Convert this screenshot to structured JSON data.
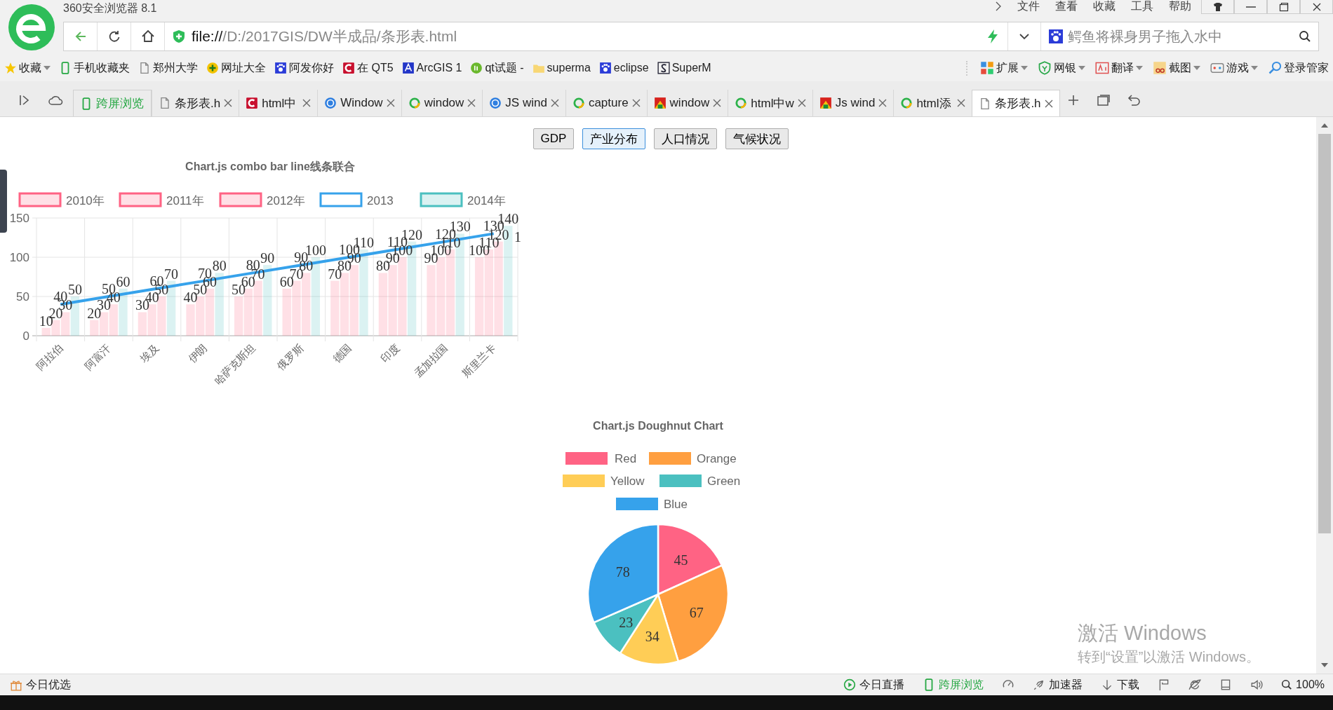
{
  "window": {
    "title": "360安全浏览器 8.1",
    "menu": [
      "文件",
      "查看",
      "收藏",
      "工具",
      "帮助"
    ]
  },
  "address_bar": {
    "scheme": "file://",
    "path": "/D:/2017GIS/DW半成品/条形表.html"
  },
  "search": {
    "value": "鳄鱼将裸身男子拖入水中"
  },
  "bookmarks": [
    {
      "label": "收藏",
      "kind": "star",
      "dropdown": true
    },
    {
      "label": "手机收藏夹",
      "kind": "phone",
      "dropdown": false
    },
    {
      "label": "郑州大学",
      "kind": "page",
      "dropdown": false
    },
    {
      "label": "网址大全",
      "kind": "plus",
      "dropdown": false
    },
    {
      "label": "阿发你好",
      "kind": "paw",
      "dropdown": false
    },
    {
      "label": "在 QT5",
      "kind": "c",
      "dropdown": false
    },
    {
      "label": "ArcGIS 1",
      "kind": "arc",
      "dropdown": false
    },
    {
      "label": "qt试题 -",
      "kind": "leaf",
      "dropdown": false
    },
    {
      "label": "superma",
      "kind": "folder",
      "dropdown": false
    },
    {
      "label": "eclipse",
      "kind": "paw",
      "dropdown": false
    },
    {
      "label": "SuperM",
      "kind": "s",
      "dropdown": false
    }
  ],
  "tools": [
    {
      "label": "扩展",
      "kind": "grid",
      "dropdown": true
    },
    {
      "label": "网银",
      "kind": "shield",
      "dropdown": true
    },
    {
      "label": "翻译",
      "kind": "translate",
      "dropdown": true
    },
    {
      "label": "截图",
      "kind": "scissors",
      "dropdown": true
    },
    {
      "label": "游戏",
      "kind": "game",
      "dropdown": true
    },
    {
      "label": "登录管家",
      "kind": "key",
      "dropdown": false
    }
  ],
  "tabs": [
    {
      "label": "跨屏浏览",
      "kind": "phone",
      "selected": false
    },
    {
      "label": "条形表.h",
      "kind": "page",
      "selected": false
    },
    {
      "label": "html中",
      "kind": "c",
      "selected": false
    },
    {
      "label": "Window",
      "kind": "globe",
      "selected": false
    },
    {
      "label": "window",
      "kind": "ring",
      "selected": false
    },
    {
      "label": "JS wind",
      "kind": "globe",
      "selected": false
    },
    {
      "label": "capture",
      "kind": "ring",
      "selected": false
    },
    {
      "label": "window",
      "kind": "mosaic",
      "selected": false
    },
    {
      "label": "html中w",
      "kind": "ring",
      "selected": false
    },
    {
      "label": "Js wind",
      "kind": "mosaic",
      "selected": false
    },
    {
      "label": "html添",
      "kind": "ring",
      "selected": false
    },
    {
      "label": "条形表.h",
      "kind": "page",
      "selected": true
    }
  ],
  "page": {
    "buttons": [
      {
        "label": "GDP",
        "selected": false
      },
      {
        "label": "产业分布",
        "selected": true
      },
      {
        "label": "人口情况",
        "selected": false
      },
      {
        "label": "气候状况",
        "selected": false
      }
    ],
    "bar_chart": {
      "chart_data": {
        "type": "bar",
        "title": "Chart.js combo bar line线条联合",
        "categories": [
          "阿拉伯",
          "阿富汗",
          "埃及",
          "伊朗",
          "哈萨克斯坦",
          "俄罗斯",
          "德国",
          "印度",
          "孟加拉国",
          "斯里兰卡"
        ],
        "series": [
          {
            "name": "2010年",
            "color": "#ff6384",
            "type": "bar",
            "values": [
              10,
              20,
              30,
              40,
              50,
              60,
              70,
              80,
              90,
              100
            ]
          },
          {
            "name": "2011年",
            "color": "#ff6384",
            "type": "bar",
            "values": [
              20,
              30,
              40,
              50,
              60,
              70,
              80,
              90,
              100,
              110
            ]
          },
          {
            "name": "2012年",
            "color": "#ff6384",
            "type": "bar",
            "values": [
              30,
              40,
              50,
              60,
              70,
              80,
              90,
              100,
              110,
              120
            ]
          },
          {
            "name": "2013",
            "color": "#36a2eb",
            "type": "line",
            "values": [
              40,
              50,
              60,
              70,
              80,
              90,
              100,
              110,
              120,
              130
            ]
          },
          {
            "name": "2014年",
            "color": "#4bc0c0",
            "type": "bar",
            "values": [
              50,
              60,
              70,
              80,
              90,
              100,
              110,
              120,
              130,
              140
            ]
          }
        ],
        "legend": "top",
        "ylim": [
          0,
          150
        ],
        "yticks": [
          0,
          50,
          100,
          150
        ],
        "data_labels": true,
        "annotations": [
          {
            "text": "1"
          }
        ]
      }
    },
    "pie_chart": {
      "chart_data": {
        "type": "pie",
        "title": "Chart.js Doughnut Chart",
        "categories": [
          "Red",
          "Orange",
          "Yellow",
          "Green",
          "Blue"
        ],
        "values": [
          45,
          67,
          34,
          23,
          78
        ],
        "colors": [
          "#ff6384",
          "#ff9f40",
          "#ffcd56",
          "#4bc0c0",
          "#36a2eb"
        ],
        "legend": "top",
        "data_labels": true
      }
    }
  },
  "activation": {
    "title": "激活 Windows",
    "text": "转到“设置”以激活 Windows。"
  },
  "status_bar": {
    "left": "今日优选",
    "items": [
      {
        "label": "今日直播",
        "kind": "play",
        "highlight": false
      },
      {
        "label": "跨屏浏览",
        "kind": "phone",
        "highlight": true
      },
      {
        "kind": "gauge"
      },
      {
        "label": "加速器",
        "kind": "rocket",
        "highlight": false
      },
      {
        "label": "下载",
        "kind": "download",
        "highlight": false
      },
      {
        "kind": "flag"
      },
      {
        "kind": "ie"
      },
      {
        "kind": "window"
      },
      {
        "kind": "sound"
      }
    ],
    "zoom": "100%"
  }
}
